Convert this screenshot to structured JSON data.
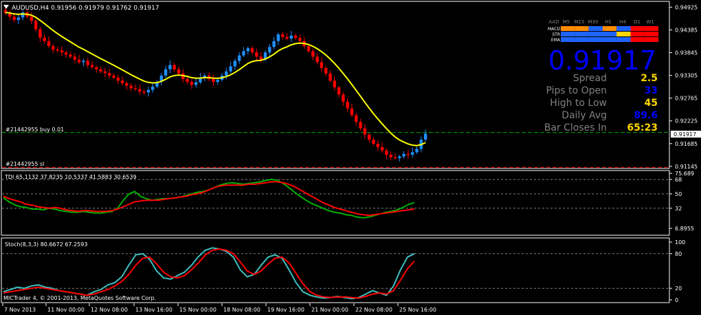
{
  "colors": {
    "background": "#000000",
    "frame": "#ffffff",
    "text": "#ffffff",
    "bull_candle": "#1e90ff",
    "bear_candle": "#ff0000",
    "ma_line": "#ffff00",
    "trade_buy_line": "#00aa00",
    "trade_sl_line": "#ff0000",
    "price_tag_bg": "#ffffff",
    "tdi_green": "#00b000",
    "tdi_red": "#ff0000",
    "stoch_main": "#40c0c0",
    "stoch_signal": "#ff0000",
    "level_line": "#808080",
    "panel_blue": "#0000ff",
    "panel_yellow": "#ffd700",
    "panel_gray": "#808080",
    "bar_orange": "#ff8c00",
    "bar_blue": "#1e64ff",
    "bar_red": "#ff0000",
    "bar_yellow": "#ffd700"
  },
  "header": {
    "symbol_line": "AUDUSD,H4  0.91956 0.91979 0.91762 0.91917"
  },
  "trades": {
    "buy_label": "#21442955 buy 0.01",
    "sl_label": "#21442955 sl"
  },
  "info_panel": {
    "timeframes": [
      "AAD",
      "M5",
      "M15",
      "M30",
      "H1",
      "H4",
      "D1",
      "W1"
    ],
    "rows": [
      {
        "label": "MACD",
        "colors": [
          "orange",
          "orange",
          "blue",
          "orange",
          "blue",
          "red",
          "red"
        ]
      },
      {
        "label": "STR",
        "colors": [
          "blue",
          "blue",
          "blue",
          "blue",
          "yellow",
          "red",
          "red"
        ]
      },
      {
        "label": "EMA",
        "colors": [
          "blue",
          "blue",
          "blue",
          "blue",
          "blue",
          "red",
          "red"
        ]
      }
    ],
    "price": "0.91917",
    "stats": [
      {
        "label": "Spread",
        "value": "2.5",
        "value_color": "yellow"
      },
      {
        "label": "Pips to Open",
        "value": "33",
        "value_color": "blue"
      },
      {
        "label": "High to Low",
        "value": "45",
        "value_color": "yellow"
      },
      {
        "label": "Daily Avg",
        "value": "89.6",
        "value_color": "blue"
      },
      {
        "label": "Bar Closes In",
        "value": "65:23",
        "value_color": "yellow"
      }
    ]
  },
  "tdi": {
    "label": "TDI 65.1132 37.8235 10.5337 41.5883 30.6539"
  },
  "stoch": {
    "label": "Stoch(8,3,3) 80.6672 67.2593"
  },
  "copyright": "MICTrader 4, © 2001-2013, MetaQuotes Software Corp.",
  "chart_data": [
    {
      "type": "candlestick",
      "title": "AUDUSD,H4",
      "ylim": [
        0.9111,
        0.9503
      ],
      "y_ticks": [
        "0.94925",
        "0.94385",
        "0.93845",
        "0.93305",
        "0.92765",
        "0.92225",
        "0.91685",
        "0.91145"
      ],
      "current_price_tag": "0.91917",
      "x_ticks": [
        "7 Nov 2013",
        "11 Nov 00:00",
        "12 Nov 08:00",
        "13 Nov 16:00",
        "15 Nov 00:00",
        "18 Nov 08:00",
        "19 Nov 16:00",
        "21 Nov 00:00",
        "22 Nov 08:00",
        "25 Nov 16:00"
      ],
      "horizontal_lines": [
        {
          "name": "buy",
          "value": 0.9195
        },
        {
          "name": "sl",
          "value": 0.9112
        }
      ],
      "closes": [
        0.9478,
        0.947,
        0.9462,
        0.9468,
        0.948,
        0.947,
        0.946,
        0.944,
        0.942,
        0.9412,
        0.94,
        0.9392,
        0.939,
        0.9385,
        0.938,
        0.9375,
        0.9368,
        0.9362,
        0.9365,
        0.9355,
        0.935,
        0.9345,
        0.934,
        0.9336,
        0.933,
        0.9325,
        0.9318,
        0.9312,
        0.9306,
        0.93,
        0.9298,
        0.9292,
        0.929,
        0.9296,
        0.9304,
        0.9315,
        0.933,
        0.9345,
        0.9355,
        0.9345,
        0.9335,
        0.9322,
        0.9315,
        0.9308,
        0.9314,
        0.9325,
        0.933,
        0.9322,
        0.9315,
        0.932,
        0.933,
        0.934,
        0.9352,
        0.9365,
        0.9378,
        0.9388,
        0.9395,
        0.9385,
        0.9375,
        0.9368,
        0.9385,
        0.9398,
        0.9412,
        0.9428,
        0.9422,
        0.9418,
        0.9425,
        0.942,
        0.9412,
        0.94,
        0.9388,
        0.9375,
        0.9362,
        0.9348,
        0.9335,
        0.9318,
        0.9302,
        0.9285,
        0.9268,
        0.9252,
        0.9236,
        0.922,
        0.9205,
        0.919,
        0.9178,
        0.9168,
        0.916,
        0.9152,
        0.9142,
        0.9136,
        0.9134,
        0.9138,
        0.9144,
        0.9142,
        0.9148,
        0.9156,
        0.9178,
        0.9192
      ]
    },
    {
      "type": "line",
      "title": "TDI 65.1132 37.8235 10.5337 41.5883 30.6539",
      "ylim": [
        0,
        75.689
      ],
      "y_ticks": [
        "75.689",
        "68",
        "50",
        "32",
        "6.8955"
      ],
      "levels": [
        68,
        50,
        32
      ],
      "series": [
        {
          "values": [
            45,
            40,
            36,
            34,
            33,
            31,
            31,
            30,
            32,
            31,
            29,
            28,
            27,
            27,
            28,
            27,
            26,
            26,
            27,
            28,
            32,
            42,
            50,
            53,
            47,
            44,
            42,
            43,
            44,
            44,
            45,
            46,
            48,
            50,
            52,
            53,
            55,
            58,
            61,
            63,
            64,
            63,
            62,
            63,
            64,
            65,
            67,
            68,
            67,
            63,
            58,
            52,
            47,
            42,
            38,
            35,
            32,
            29,
            27,
            26,
            24,
            23,
            21,
            20,
            21,
            23,
            25,
            27,
            28,
            30,
            33,
            37,
            39
          ]
        },
        {
          "values": [
            47,
            44,
            42,
            40,
            37,
            36,
            34,
            33,
            32,
            33,
            32,
            30,
            29,
            28,
            29,
            29,
            28,
            28,
            28,
            29,
            31,
            34,
            37,
            40,
            41,
            42,
            42,
            42,
            43,
            44,
            45,
            46,
            47,
            49,
            50,
            52,
            55,
            58,
            60,
            61,
            61,
            61,
            61,
            62,
            62,
            63,
            64,
            65,
            65,
            64,
            62,
            59,
            55,
            51,
            47,
            43,
            39,
            36,
            33,
            31,
            29,
            27,
            25,
            24,
            23,
            24,
            25,
            26,
            27,
            28,
            29,
            30,
            31
          ]
        }
      ]
    },
    {
      "type": "line",
      "title": "Stoch(8,3,3) 80.6672 67.2593",
      "ylim": [
        0,
        100
      ],
      "y_ticks": [
        "100",
        "80",
        "20",
        "0"
      ],
      "levels": [
        80,
        20
      ],
      "series": [
        {
          "values": [
            14,
            18,
            22,
            20,
            24,
            26,
            22,
            20,
            16,
            14,
            12,
            10,
            8,
            14,
            18,
            26,
            30,
            40,
            60,
            78,
            80,
            70,
            50,
            38,
            36,
            42,
            48,
            60,
            75,
            86,
            90,
            88,
            84,
            74,
            52,
            40,
            44,
            60,
            74,
            78,
            72,
            52,
            30,
            14,
            8,
            5,
            3,
            4,
            6,
            4,
            2,
            4,
            10,
            16,
            12,
            8,
            24,
            52,
            74,
            80
          ]
        },
        {
          "values": [
            12,
            14,
            16,
            18,
            20,
            22,
            20,
            18,
            16,
            14,
            12,
            10,
            8,
            10,
            14,
            18,
            24,
            32,
            44,
            60,
            72,
            74,
            62,
            48,
            40,
            38,
            42,
            52,
            64,
            78,
            86,
            88,
            86,
            80,
            66,
            50,
            44,
            50,
            62,
            72,
            74,
            64,
            46,
            28,
            14,
            8,
            5,
            4,
            5,
            5,
            4,
            3,
            6,
            10,
            12,
            10,
            16,
            34,
            54,
            67
          ]
        }
      ]
    }
  ]
}
